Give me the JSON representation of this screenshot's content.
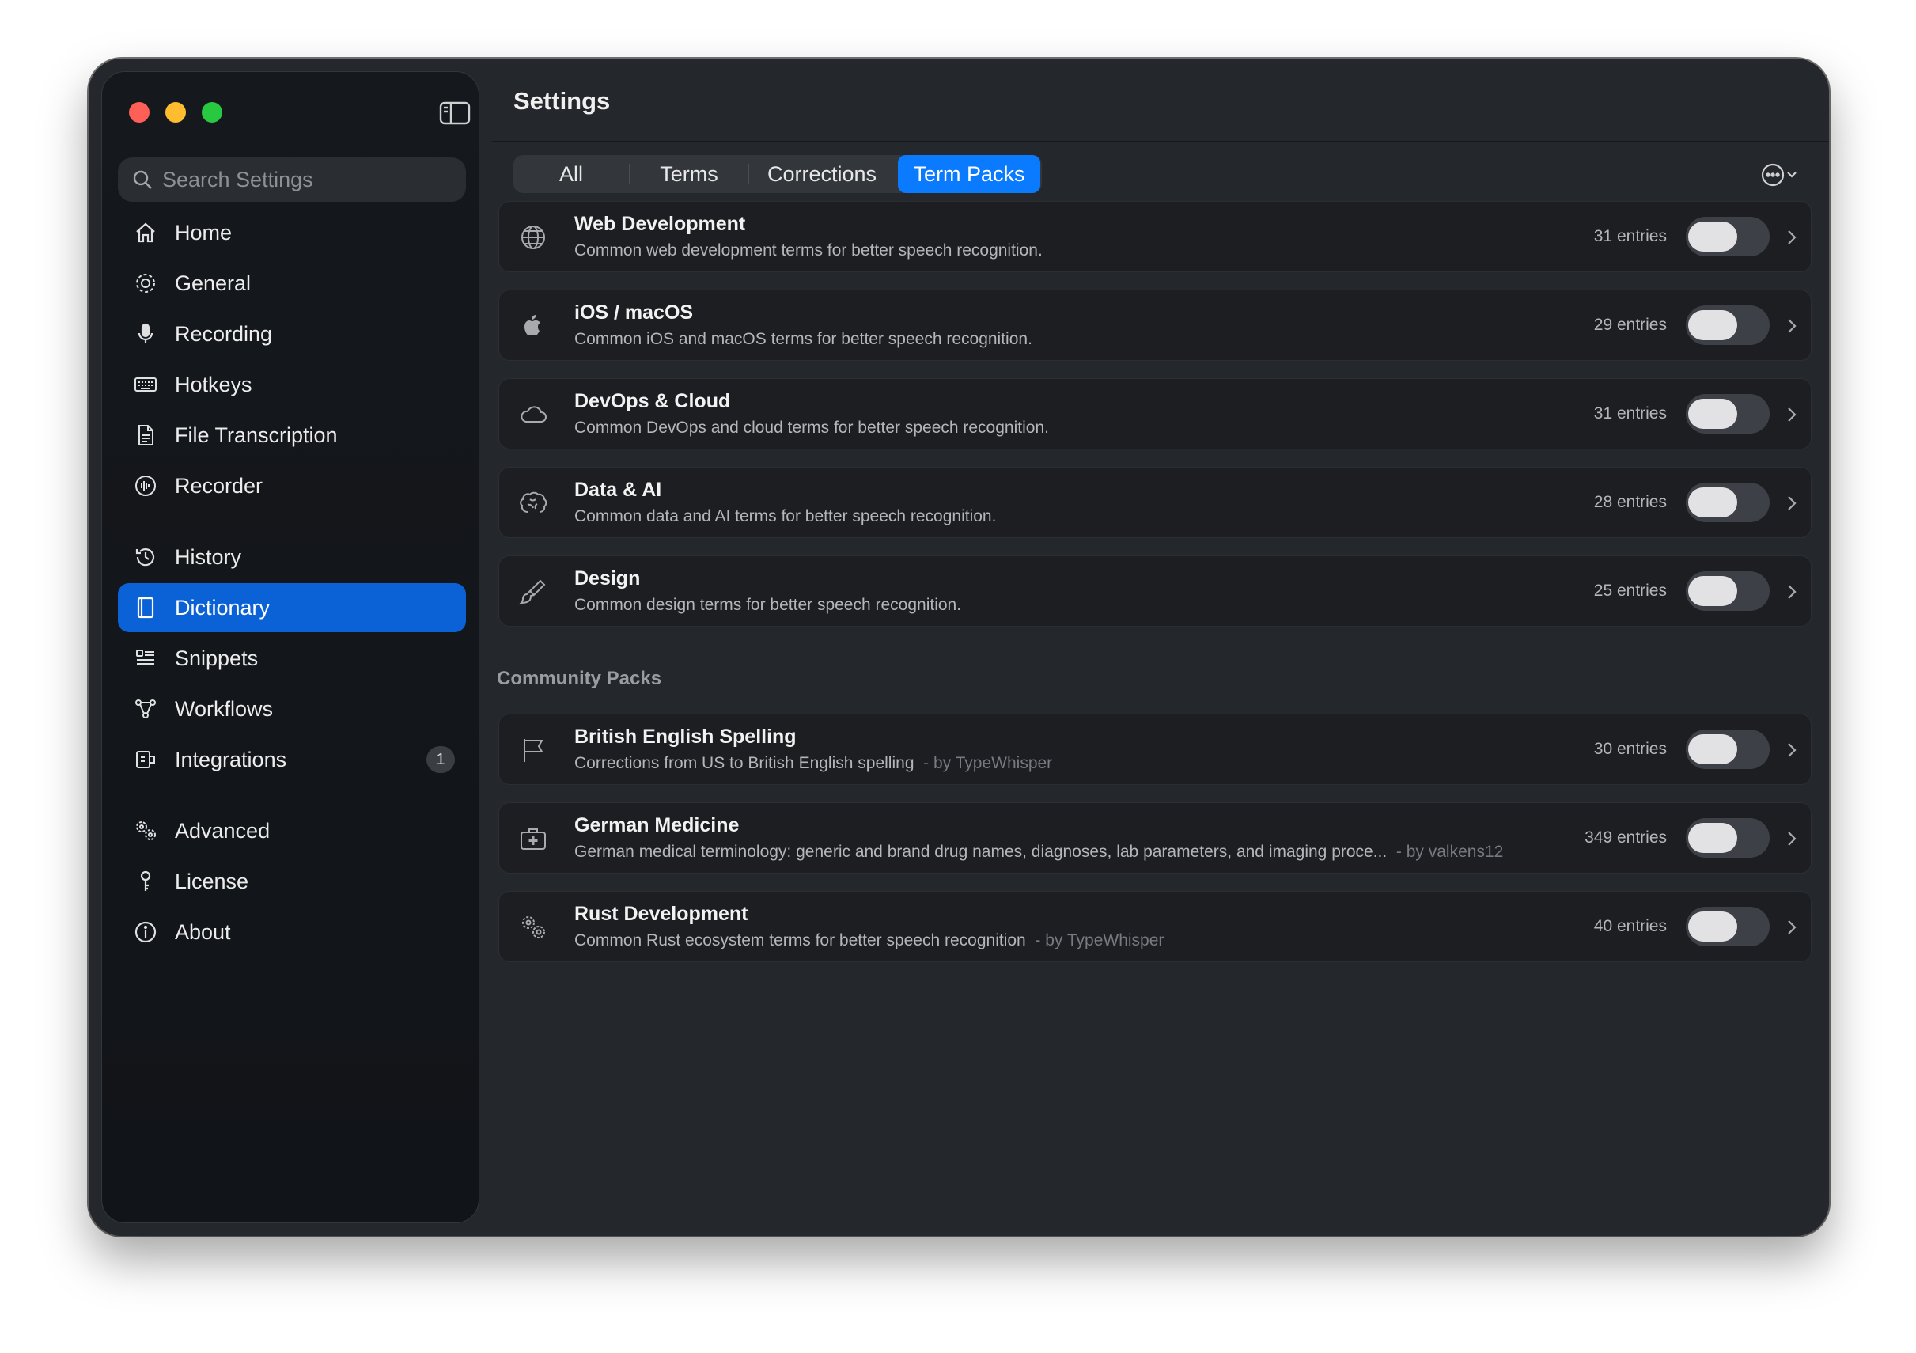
{
  "window": {
    "title": "Settings"
  },
  "search": {
    "placeholder": "Search Settings"
  },
  "sidebar": {
    "items": [
      {
        "label": "Home",
        "icon": "home-icon"
      },
      {
        "label": "General",
        "icon": "gear-icon"
      },
      {
        "label": "Recording",
        "icon": "microphone-icon"
      },
      {
        "label": "Hotkeys",
        "icon": "keyboard-icon"
      },
      {
        "label": "File Transcription",
        "icon": "document-icon"
      },
      {
        "label": "Recorder",
        "icon": "waveform-icon"
      },
      {
        "label": "History",
        "icon": "clock-icon"
      },
      {
        "label": "Dictionary",
        "icon": "book-icon",
        "active": true
      },
      {
        "label": "Snippets",
        "icon": "list-icon"
      },
      {
        "label": "Workflows",
        "icon": "workflow-icon"
      },
      {
        "label": "Integrations",
        "icon": "plugin-icon",
        "badge": "1"
      },
      {
        "label": "Advanced",
        "icon": "gears-icon"
      },
      {
        "label": "License",
        "icon": "key-icon"
      },
      {
        "label": "About",
        "icon": "info-icon"
      }
    ]
  },
  "tabs": {
    "items": [
      {
        "label": "All"
      },
      {
        "label": "Terms"
      },
      {
        "label": "Corrections"
      },
      {
        "label": "Term Packs",
        "active": true
      }
    ]
  },
  "packs": [
    {
      "name": "Web Development",
      "description": "Common web development terms for better speech recognition.",
      "author": "",
      "count": "31 entries",
      "icon": "globe-icon",
      "enabled": false
    },
    {
      "name": "iOS / macOS",
      "description": "Common iOS and macOS terms for better speech recognition.",
      "author": "",
      "count": "29 entries",
      "icon": "apple-icon",
      "enabled": false
    },
    {
      "name": "DevOps & Cloud",
      "description": "Common DevOps and cloud terms for better speech recognition.",
      "author": "",
      "count": "31 entries",
      "icon": "cloud-icon",
      "enabled": false
    },
    {
      "name": "Data & AI",
      "description": "Common data and AI terms for better speech recognition.",
      "author": "",
      "count": "28 entries",
      "icon": "brain-icon",
      "enabled": false
    },
    {
      "name": "Design",
      "description": "Common design terms for better speech recognition.",
      "author": "",
      "count": "25 entries",
      "icon": "paintbrush-icon",
      "enabled": false
    }
  ],
  "community": {
    "header": "Community Packs",
    "packs": [
      {
        "name": "British English Spelling",
        "description": "Corrections from US to British English spelling",
        "author": "- by TypeWhisper",
        "count": "30 entries",
        "icon": "flag-icon",
        "enabled": false
      },
      {
        "name": "German Medicine",
        "description": "German medical terminology: generic and brand drug names, diagnoses, lab parameters, and imaging proce...",
        "author": "- by valkens12",
        "count": "349 entries",
        "icon": "medical-kit-icon",
        "enabled": false
      },
      {
        "name": "Rust Development",
        "description": "Common Rust ecosystem terms for better speech recognition",
        "author": "- by TypeWhisper",
        "count": "40 entries",
        "icon": "gears-icon",
        "enabled": false
      }
    ]
  },
  "colors": {
    "accent": "#0a7aff",
    "sidebar_active": "#0b62d6",
    "background": "#24272c",
    "card": "#1c1e22"
  }
}
